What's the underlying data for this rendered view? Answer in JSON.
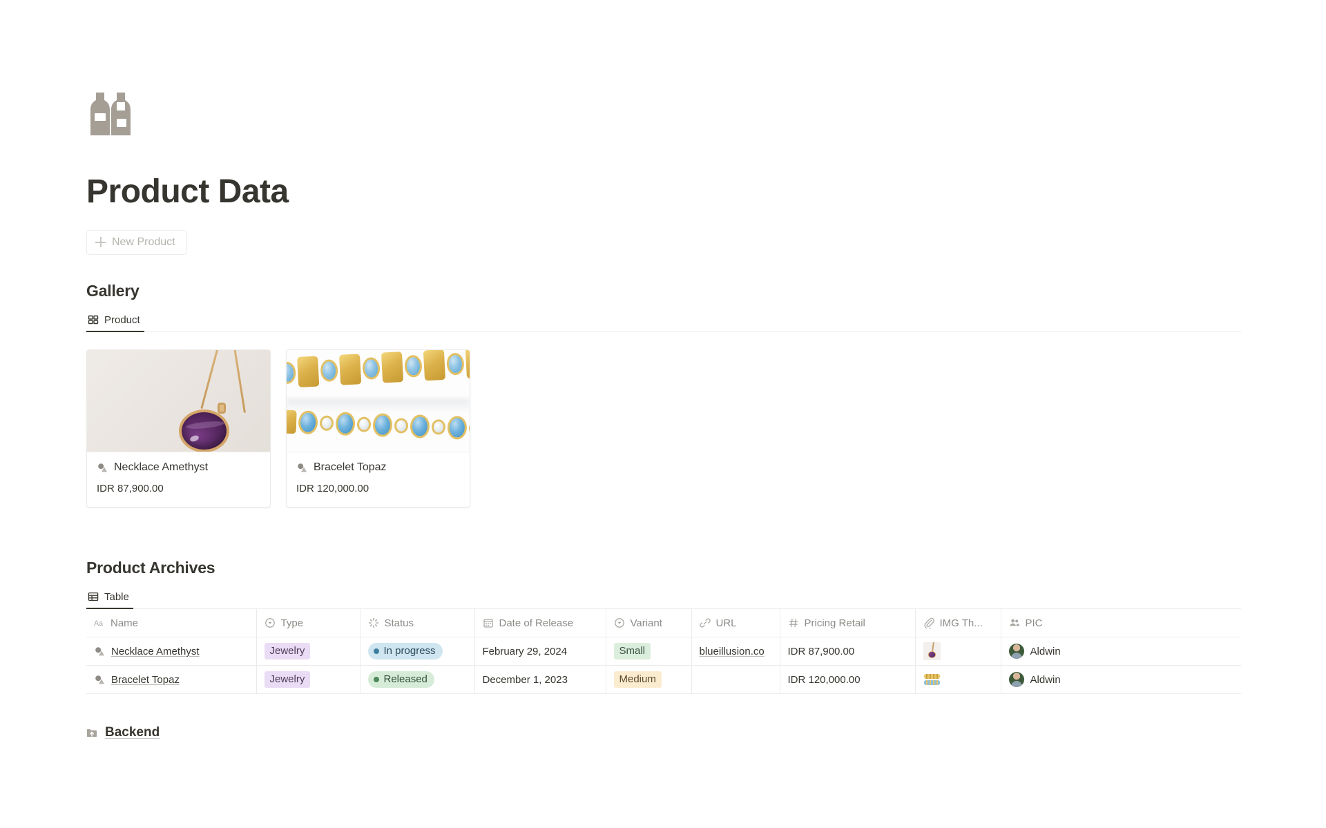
{
  "page": {
    "icon_name": "two-bottles-icon",
    "icon_color": "#a49e94",
    "title": "Product Data",
    "new_button_label": "New Product"
  },
  "gallery": {
    "heading": "Gallery",
    "tabs": [
      {
        "label": "Product",
        "icon": "gallery-grid-icon",
        "active": true
      }
    ],
    "cards": [
      {
        "icon": "shapes-icon",
        "title": "Necklace Amethyst",
        "price": "IDR 87,900.00",
        "image": "amethyst-necklace-photo"
      },
      {
        "icon": "shapes-icon",
        "title": "Bracelet Topaz",
        "price": "IDR 120,000.00",
        "image": "topaz-bracelet-photo"
      }
    ]
  },
  "archives": {
    "heading": "Product Archives",
    "tabs": [
      {
        "label": "Table",
        "icon": "table-icon",
        "active": true
      }
    ],
    "columns": [
      {
        "label": "Name",
        "icon": "text-aa-icon"
      },
      {
        "label": "Type",
        "icon": "select-icon"
      },
      {
        "label": "Status",
        "icon": "status-spinner-icon"
      },
      {
        "label": "Date of Release",
        "icon": "calendar-icon"
      },
      {
        "label": "Variant",
        "icon": "select-icon"
      },
      {
        "label": "URL",
        "icon": "link-icon"
      },
      {
        "label": "Pricing Retail",
        "icon": "number-hash-icon"
      },
      {
        "label": "IMG Th...",
        "icon": "paperclip-icon"
      },
      {
        "label": "PIC",
        "icon": "people-icon"
      }
    ],
    "rows": [
      {
        "name": "Necklace Amethyst",
        "name_icon": "shapes-icon",
        "type": "Jewelry",
        "status": "In progress",
        "status_color": "#cfe5f0",
        "status_dot_color": "#3d7f9e",
        "date": "February 29, 2024",
        "variant": "Small",
        "variant_color": "#dbeedd",
        "url": "blueillusion.co",
        "price": "IDR 87,900.00",
        "thumb": "amethyst-necklace-thumb",
        "pic": "Aldwin"
      },
      {
        "name": "Bracelet Topaz",
        "name_icon": "shapes-icon",
        "type": "Jewelry",
        "status": "Released",
        "status_color": "#d6ecd8",
        "status_dot_color": "#4f8758",
        "date": "December 1, 2023",
        "variant": "Medium",
        "variant_color": "#fbecd0",
        "url": "",
        "price": "IDR 120,000.00",
        "thumb": "topaz-bracelet-thumb",
        "pic": "Aldwin"
      }
    ]
  },
  "footer": {
    "backend_label": "Backend",
    "backend_icon": "folder-upload-icon"
  }
}
